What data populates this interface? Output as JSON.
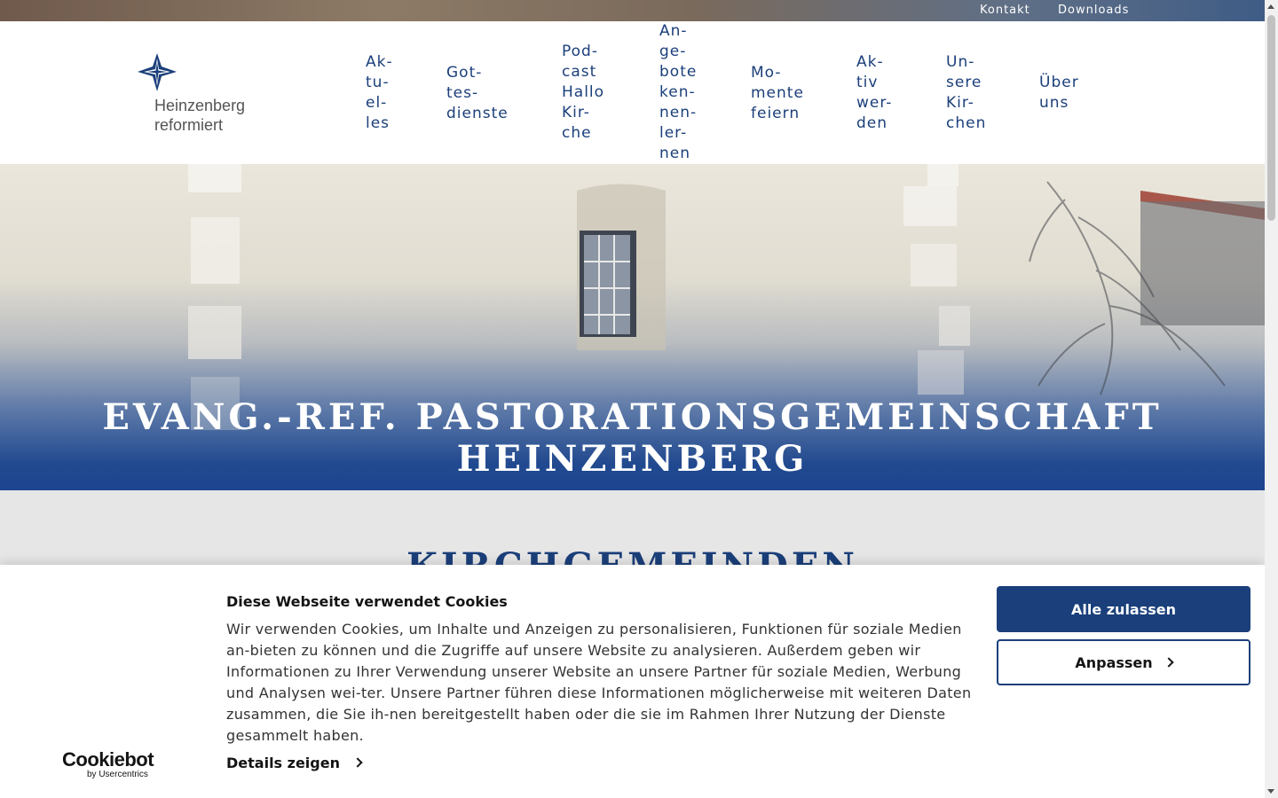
{
  "topbar": {
    "links": [
      {
        "label": "Kontakt"
      },
      {
        "label": "Downloads"
      }
    ]
  },
  "logo": {
    "line1": "Heinzenberg",
    "line2": "reformiert"
  },
  "nav": {
    "items": [
      {
        "label": "Ak-\ntu-\nel-\nles"
      },
      {
        "label": "Got-\ntes-\ndienste"
      },
      {
        "label": "Pod-\ncast\nHallo\nKir-\nche"
      },
      {
        "label": "An-\nge-\nbote\nken-\nnen-\nler-\nnen"
      },
      {
        "label": "Mo-\nmente\nfeiern"
      },
      {
        "label": "Ak-\ntiv\nwer-\nden"
      },
      {
        "label": "Un-\nsere\nKir-\nchen"
      },
      {
        "label": "Über\nuns"
      }
    ]
  },
  "hero": {
    "title": "EVANG.-REF. PASTORATIONSGEMEINSCHAFT HEINZENBERG"
  },
  "section": {
    "title": "KIRCHGEMEINDEN"
  },
  "cookie": {
    "title": "Diese Webseite verwendet Cookies",
    "text": "Wir verwenden Cookies, um Inhalte und Anzeigen zu personalisieren, Funktionen für soziale Medien an-bieten zu können und die Zugriffe auf unsere Website zu analysieren. Außerdem geben wir Informationen zu Ihrer Verwendung unserer Website an unsere Partner für soziale Medien, Werbung und Analysen wei-ter. Unsere Partner führen diese Informationen möglicherweise mit weiteren Daten zusammen, die Sie ih-nen bereitgestellt haben oder die sie im Rahmen Ihrer Nutzung der Dienste gesammelt haben.",
    "details_label": "Details zeigen",
    "allow_all_label": "Alle zulassen",
    "customize_label": "Anpassen",
    "brand_main": "Cookiebot",
    "brand_sub": "by Usercentrics"
  },
  "colors": {
    "brand_blue": "#1a3f7a",
    "nav_text": "#1b3f7a"
  }
}
